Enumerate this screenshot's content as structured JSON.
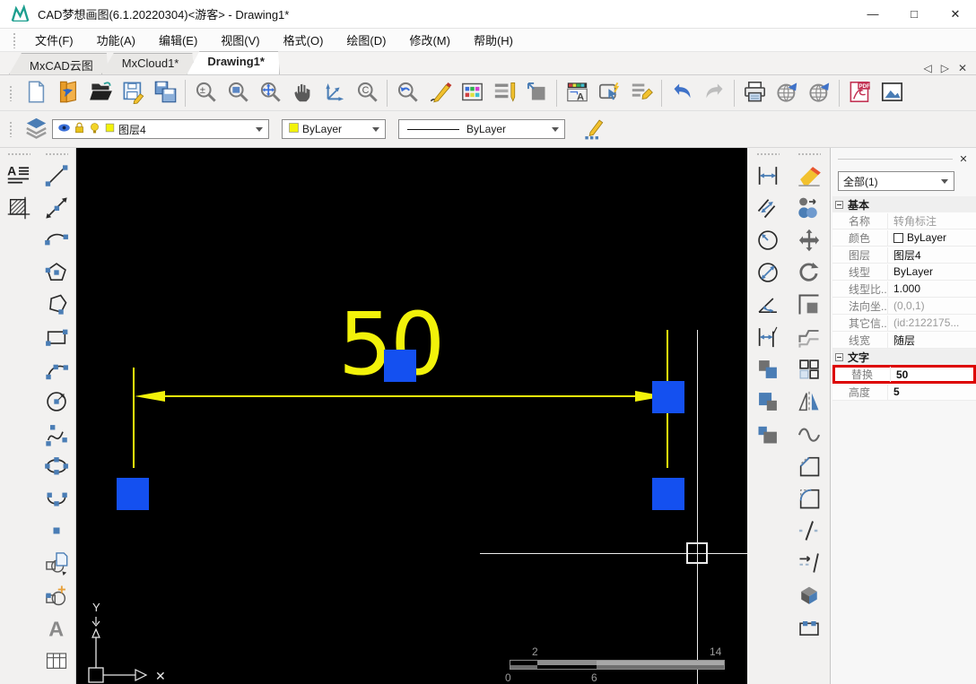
{
  "window": {
    "title": "CAD梦想画图(6.1.20220304)<游客> - Drawing1*",
    "controls": {
      "minimize": "—",
      "maximize": "□",
      "close": "✕"
    }
  },
  "menu": {
    "items": [
      "文件(F)",
      "功能(A)",
      "编辑(E)",
      "视图(V)",
      "格式(O)",
      "绘图(D)",
      "修改(M)",
      "帮助(H)"
    ]
  },
  "tabs": {
    "items": [
      {
        "label": "MxCAD云图",
        "active": false
      },
      {
        "label": "MxCloud1*",
        "active": false
      },
      {
        "label": "Drawing1*",
        "active": true
      }
    ],
    "nav_prev": "◁",
    "nav_next": "▷",
    "nav_close": "✕"
  },
  "main_toolbar": {
    "items": [
      "new",
      "open-drawing",
      "open-folder",
      "save",
      "save-as",
      "|",
      "zoom-scale",
      "zoom-window",
      "zoom-extents",
      "pan",
      "ucs-axes",
      "zoom-center",
      "|",
      "zoom-previous",
      "sketch",
      "color-palette",
      "linetype-manager",
      "layer-box",
      "|",
      "text-style",
      "select-style",
      "format-brush",
      "|",
      "undo",
      "redo",
      "|",
      "print",
      "publish-web",
      "open-web",
      "|",
      "export-pdf",
      "insert-image"
    ]
  },
  "layer_toolbar": {
    "layer_select": {
      "value": "图层4",
      "icons": [
        "visibility",
        "lock",
        "light",
        "swatch"
      ]
    },
    "color_select": {
      "value": "ByLayer"
    },
    "linetype_select": {
      "value": "ByLayer"
    }
  },
  "left_palette": {
    "col1": [
      "text-format",
      "hatch"
    ],
    "col2": [
      "line",
      "construction-line",
      "arc",
      "polygon",
      "polygon-irregular",
      "rectangle",
      "arc-3point",
      "circle-radius",
      "spline",
      "ellipse",
      "ellipse-arc",
      "point",
      "insert-block",
      "create-block",
      "single-text",
      "table"
    ]
  },
  "right_palette": {
    "col1": [
      "dim-linear",
      "dim-aligned",
      "dim-radius",
      "dim-diameter",
      "dim-angular",
      "dim-continue",
      "draworder-front",
      "draworder-back",
      "draworder-under"
    ],
    "col2": [
      "erase",
      "match-properties",
      "move",
      "rotate",
      "scale",
      "offset",
      "array",
      "mirror",
      "revision-cloud",
      "chamfer",
      "fillet",
      "break",
      "trim",
      "explode",
      "stretch"
    ]
  },
  "canvas": {
    "dimension_text": "50",
    "ucs_y_label": "Y",
    "ucs_x_label": "X",
    "scalebar": {
      "label_2": "2",
      "label_14": "14",
      "label_0": "0",
      "label_6": "6"
    }
  },
  "properties": {
    "close": "✕",
    "filter_value": "全部(1)",
    "sections": [
      {
        "title": "基本",
        "rows": [
          {
            "label": "名称",
            "value": "转角标注",
            "muted": true
          },
          {
            "label": "颜色",
            "value": "ByLayer",
            "swatch": true
          },
          {
            "label": "图层",
            "value": "图层4"
          },
          {
            "label": "线型",
            "value": "ByLayer"
          },
          {
            "label": "线型比...",
            "value": "1.000"
          },
          {
            "label": "法向坐...",
            "value": "(0,0,1)",
            "muted": true
          },
          {
            "label": "其它信...",
            "value": "(id:2122175...",
            "muted": true
          },
          {
            "label": "线宽",
            "value": "随层"
          }
        ]
      },
      {
        "title": "文字",
        "rows": [
          {
            "label": "替换",
            "value": "50",
            "bold": true,
            "highlighted": true
          },
          {
            "label": "高度",
            "value": "5",
            "bold": true
          }
        ]
      }
    ]
  },
  "colors": {
    "grip_blue": "#1450f0",
    "dim_yellow": "#f2f20a",
    "highlight_red": "#dd0000",
    "accent_blue": "#4a7db5"
  }
}
